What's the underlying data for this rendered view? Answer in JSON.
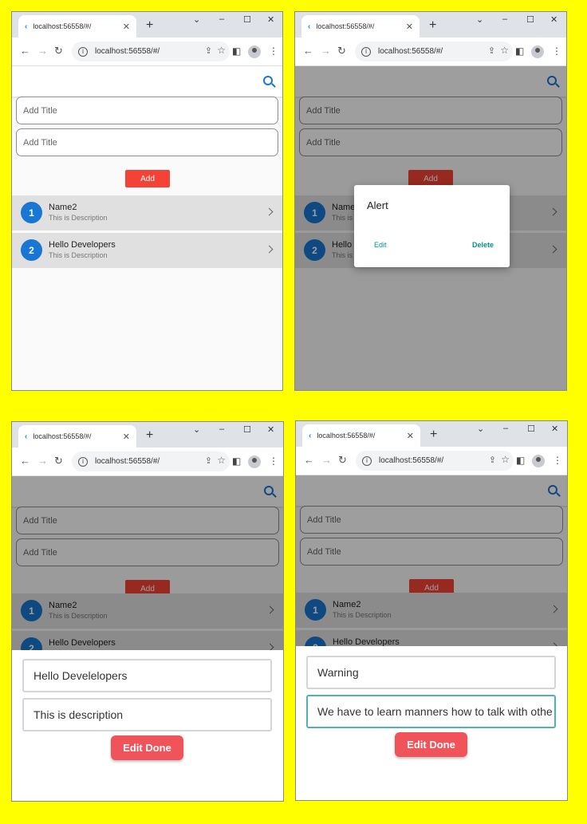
{
  "browser": {
    "tab_title": "localhost:56558/#/",
    "url": "localhost:56558/#/",
    "newtab": "+",
    "tab_close": "✕",
    "min": "–",
    "max": "☐",
    "close": "✕",
    "tab_menu": "⌄",
    "back": "←",
    "forward": "→",
    "reload": "↻",
    "info": "i",
    "share": "⇪",
    "star": "☆",
    "sidepanel": "◧",
    "menu": "⋮"
  },
  "form": {
    "title_placeholder": "Add Title",
    "description_placeholder": "Add Title",
    "add_label": "Add"
  },
  "list": [
    {
      "avatar": "1",
      "title": "Name2",
      "subtitle": "This is Description"
    },
    {
      "avatar": "2",
      "title": "Hello Developers",
      "subtitle": "This is Description"
    }
  ],
  "dialog": {
    "title": "Alert",
    "edit": "Edit",
    "delete": "Delete"
  },
  "edit_sheet_1": {
    "title_value": "Hello Develelopers",
    "description_value": "This is description",
    "done_label": "Edit Done"
  },
  "edit_sheet_2": {
    "title_value": "Warning",
    "description_value": "We have to learn manners how to talk with othe",
    "done_label": "Edit Done"
  },
  "icons": [
    "flutter-icon",
    "search-icon",
    "chevron-right-icon",
    "star-icon",
    "share-icon",
    "profile-icon"
  ]
}
